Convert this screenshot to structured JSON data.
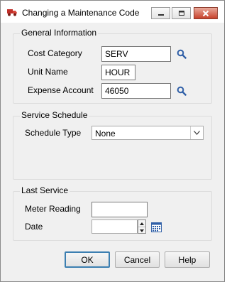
{
  "window": {
    "title": "Changing a Maintenance Code"
  },
  "title_buttons": {
    "minimize": "minimize-icon",
    "maximize": "maximize-icon",
    "close": "close-icon"
  },
  "general": {
    "label": "General Information",
    "cost_category": {
      "label": "Cost Category",
      "value": "SERV"
    },
    "unit_name": {
      "label": "Unit Name",
      "value": "HOUR"
    },
    "expense_account": {
      "label": "Expense Account",
      "value": "46050"
    }
  },
  "schedule": {
    "label": "Service Schedule",
    "schedule_type": {
      "label": "Schedule Type",
      "value": "None"
    }
  },
  "last_service": {
    "label": "Last Service",
    "meter_reading": {
      "label": "Meter Reading",
      "value": ""
    },
    "date": {
      "label": "Date",
      "value": ""
    }
  },
  "buttons": {
    "ok": "OK",
    "cancel": "Cancel",
    "help": "Help"
  },
  "colors": {
    "accent": "#3c7fb1",
    "close_button": "#c7402b",
    "lookup_icon": "#2f5fa7"
  }
}
